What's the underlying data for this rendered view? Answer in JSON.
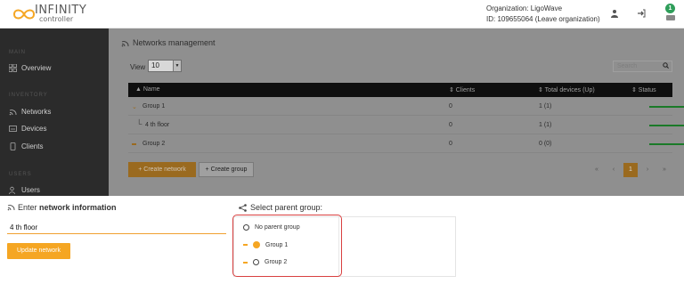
{
  "header": {
    "logo_text": "INFINITY",
    "logo_sub": "controller",
    "org_label": "Organization: LigoWave",
    "org_id": "ID: 109655064 (Leave organization)",
    "notif_count": "1"
  },
  "sidebar": {
    "section_main": "MAIN",
    "overview": "Overview",
    "section_inventory": "INVENTORY",
    "networks": "Networks",
    "devices": "Devices",
    "clients": "Clients",
    "section_users": "USERS",
    "users": "Users"
  },
  "main": {
    "title": "Networks management",
    "view_label": "View",
    "view_value": "10",
    "search_placeholder": "Search",
    "columns": [
      "▲ Name",
      "⇕ Clients",
      "⇕ Total devices (Up)",
      "⇕ Status"
    ],
    "rows": [
      {
        "name": "Group 1",
        "clients": "0",
        "devices": "1 (1)"
      },
      {
        "name": "4 th floor",
        "clients": "0",
        "devices": "1 (1)"
      },
      {
        "name": "Group 2",
        "clients": "0",
        "devices": "0 (0)"
      }
    ],
    "create_network": "+ Create network",
    "create_group": "+ Create group",
    "pages": [
      "«",
      "‹",
      "1",
      "›",
      "»"
    ]
  },
  "form": {
    "enter_prefix": "Enter ",
    "enter_bold": "network information",
    "name_value": "4 th floor",
    "update_button": "Update network",
    "parent_title": "Select parent group:",
    "no_parent": "No parent group",
    "group1": "Group 1",
    "group2": "Group 2"
  },
  "colors": {
    "accent": "#f5a623",
    "status_ok": "#1a7a28",
    "highlight": "#d94040"
  }
}
